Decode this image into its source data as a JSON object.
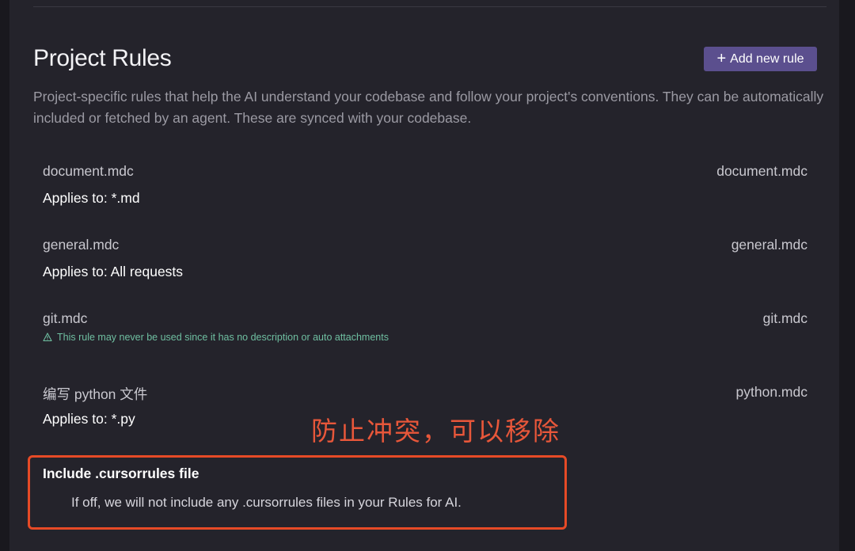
{
  "section": {
    "title": "Project Rules",
    "add_button_label": "Add new rule",
    "description": "Project-specific rules that help the AI understand your codebase and follow your project's conventions. They can be automatically included or fetched by an agent. These are synced with your codebase."
  },
  "rules": [
    {
      "name": "document.mdc",
      "file": "document.mdc",
      "applies": "Applies to: *.md"
    },
    {
      "name": "general.mdc",
      "file": "general.mdc",
      "applies": "Applies to: All requests"
    },
    {
      "name": "git.mdc",
      "file": "git.mdc",
      "warning": "This rule may never be used since it has no description or auto attachments",
      "warning_icon": "warning-triangle-icon"
    },
    {
      "name": "编写 python 文件",
      "file": "python.mdc",
      "applies": "Applies to: *.py"
    }
  ],
  "include_cursorrules": {
    "title": "Include .cursorrules file",
    "description": "If off, we will not include any .cursorrules files in your Rules for AI."
  },
  "annotation": {
    "text": "防止冲突，可以移除",
    "color": "#e64a26"
  },
  "colors": {
    "accent_button": "#5b4f8e",
    "warning_text": "#6fbfa1",
    "panel_bg": "#24232b"
  }
}
